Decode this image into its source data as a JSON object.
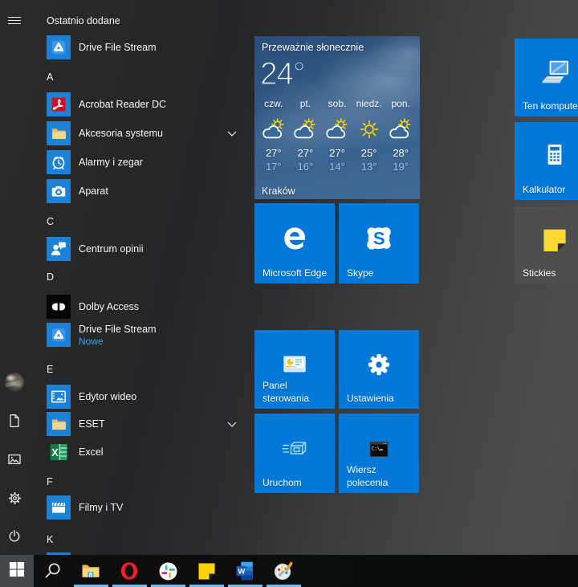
{
  "accent_color": "#0078d7",
  "start_menu": {
    "rail": {
      "menu_button": "menu",
      "bottom_items": [
        {
          "name": "user",
          "icon": "avatar"
        },
        {
          "name": "documents",
          "icon": "document"
        },
        {
          "name": "pictures",
          "icon": "pictures"
        },
        {
          "name": "settings",
          "icon": "gear"
        },
        {
          "name": "power",
          "icon": "power"
        }
      ]
    },
    "app_list": {
      "rows": [
        {
          "type": "header",
          "label": "Ostatnio dodane"
        },
        {
          "type": "app",
          "label": "Drive File Stream",
          "icon": "drive"
        },
        {
          "type": "header",
          "label": "A"
        },
        {
          "type": "app",
          "label": "Acrobat Reader DC",
          "icon": "acrobat"
        },
        {
          "type": "app",
          "label": "Akcesoria systemu",
          "icon": "folder",
          "chevron": true
        },
        {
          "type": "app",
          "label": "Alarmy i zegar",
          "icon": "alarm"
        },
        {
          "type": "app",
          "label": "Aparat",
          "icon": "camera"
        },
        {
          "type": "header",
          "label": "C"
        },
        {
          "type": "app",
          "label": "Centrum opinii",
          "icon": "feedback"
        },
        {
          "type": "header",
          "label": "D"
        },
        {
          "type": "app",
          "label": "Dolby Access",
          "icon": "dolby"
        },
        {
          "type": "app",
          "label": "Drive File Stream",
          "sub": "Nowe",
          "icon": "drive"
        },
        {
          "type": "header",
          "label": "E"
        },
        {
          "type": "app",
          "label": "Edytor wideo",
          "icon": "video"
        },
        {
          "type": "app",
          "label": "ESET",
          "icon": "folder",
          "chevron": true
        },
        {
          "type": "app",
          "label": "Excel",
          "icon": "excel"
        },
        {
          "type": "header",
          "label": "F"
        },
        {
          "type": "app",
          "label": "Filmy i TV",
          "icon": "movies"
        },
        {
          "type": "header",
          "label": "K"
        },
        {
          "type": "partial"
        }
      ]
    }
  },
  "weather_tile": {
    "condition": "Przeważnie słonecznie",
    "temperature": "24°",
    "city": "Kraków",
    "days": [
      {
        "name": "czw.",
        "icon": "sun-cloud",
        "high": "27°",
        "low": "17°"
      },
      {
        "name": "pt.",
        "icon": "sun-cloud",
        "high": "27°",
        "low": "16°"
      },
      {
        "name": "sob.",
        "icon": "sun-cloud",
        "high": "27°",
        "low": "14°"
      },
      {
        "name": "niedz.",
        "icon": "sun",
        "high": "25°",
        "low": "13°"
      },
      {
        "name": "pon.",
        "icon": "sun-cloud",
        "high": "28°",
        "low": "19°"
      }
    ]
  },
  "tiles": [
    {
      "label": "Microsoft Edge",
      "icon": "edge",
      "color": "blue"
    },
    {
      "label": "Skype",
      "icon": "skype",
      "color": "blue"
    },
    {
      "label": "Panel\nsterowania",
      "icon": "control-panel",
      "color": "blue"
    },
    {
      "label": "Ustawienia",
      "icon": "settings-gear",
      "color": "blue"
    },
    {
      "label": "Uruchom",
      "icon": "run",
      "color": "blue"
    },
    {
      "label": "Wiersz\npolecenia",
      "icon": "command-prompt",
      "color": "blue"
    },
    {
      "label": "Ten komputer",
      "icon": "computer",
      "color": "blue"
    },
    {
      "label": "Kalkulator",
      "icon": "calculator",
      "color": "blue"
    },
    {
      "label": "Stickies",
      "icon": "stickies",
      "color": "gray"
    }
  ],
  "taskbar": {
    "items": [
      {
        "name": "search",
        "icon": "search",
        "running": false
      },
      {
        "name": "file-explorer",
        "icon": "explorer",
        "running": true
      },
      {
        "name": "opera",
        "icon": "opera",
        "running": true
      },
      {
        "name": "slack",
        "icon": "slack",
        "running": true
      },
      {
        "name": "sticky-notes",
        "icon": "sticky",
        "running": true
      },
      {
        "name": "word",
        "icon": "word",
        "running": true
      },
      {
        "name": "paint-3d",
        "icon": "paint",
        "running": true
      }
    ]
  }
}
